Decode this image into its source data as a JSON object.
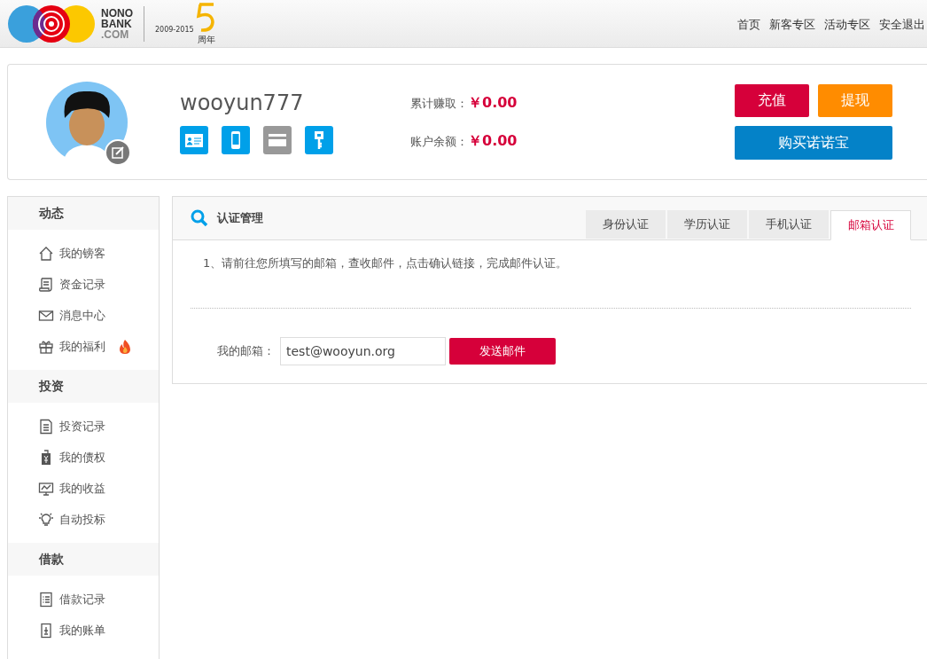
{
  "logo": {
    "name_lines": [
      "NONO",
      "BANK",
      ".COM"
    ],
    "anniversary_years": "2009-2015",
    "anniversary_label": "周年"
  },
  "nav": [
    "首页",
    "新客专区",
    "活动专区",
    "安全退出"
  ],
  "profile": {
    "username": "wooyun777",
    "verifications": [
      {
        "kind": "id-card",
        "verified": true
      },
      {
        "kind": "phone",
        "verified": true
      },
      {
        "kind": "bank-card",
        "verified": false
      },
      {
        "kind": "key",
        "verified": true
      }
    ],
    "stats": [
      {
        "label": "累计赚取：",
        "value": "￥0.00"
      },
      {
        "label": "账户余额：",
        "value": "￥0.00"
      }
    ],
    "buttons": [
      {
        "label": "充值",
        "kind": "red"
      },
      {
        "label": "提现",
        "kind": "orange"
      },
      {
        "label": "购买诺诺宝",
        "kind": "blue"
      }
    ]
  },
  "sidebar": [
    {
      "title": "动态",
      "items": [
        {
          "label": "我的镑客",
          "kind": "home",
          "hot": false
        },
        {
          "label": "资金记录",
          "kind": "scroll",
          "hot": false
        },
        {
          "label": "消息中心",
          "kind": "mail",
          "hot": false
        },
        {
          "label": "我的福利",
          "kind": "gift",
          "hot": true
        }
      ]
    },
    {
      "title": "投资",
      "items": [
        {
          "label": "投资记录",
          "kind": "doc",
          "hot": false
        },
        {
          "label": "我的债权",
          "kind": "tag",
          "hot": false
        },
        {
          "label": "我的收益",
          "kind": "chart",
          "hot": false
        },
        {
          "label": "自动投标",
          "kind": "bulb",
          "hot": false
        }
      ]
    },
    {
      "title": "借款",
      "items": [
        {
          "label": "借款记录",
          "kind": "list",
          "hot": false
        },
        {
          "label": "我的账单",
          "kind": "bill",
          "hot": false
        }
      ]
    }
  ],
  "panel": {
    "title": "认证管理",
    "tabs": [
      {
        "label": "身份认证",
        "selected": false
      },
      {
        "label": "学历认证",
        "selected": false
      },
      {
        "label": "手机认证",
        "selected": false
      },
      {
        "label": "邮箱认证",
        "selected": true
      }
    ],
    "instruction": "1、请前往您所填写的邮箱，查收邮件，点击确认链接，完成邮件认证。",
    "email_label": "我的邮箱：",
    "email_value": "test@wooyun.org",
    "send_button": "发送邮件"
  }
}
